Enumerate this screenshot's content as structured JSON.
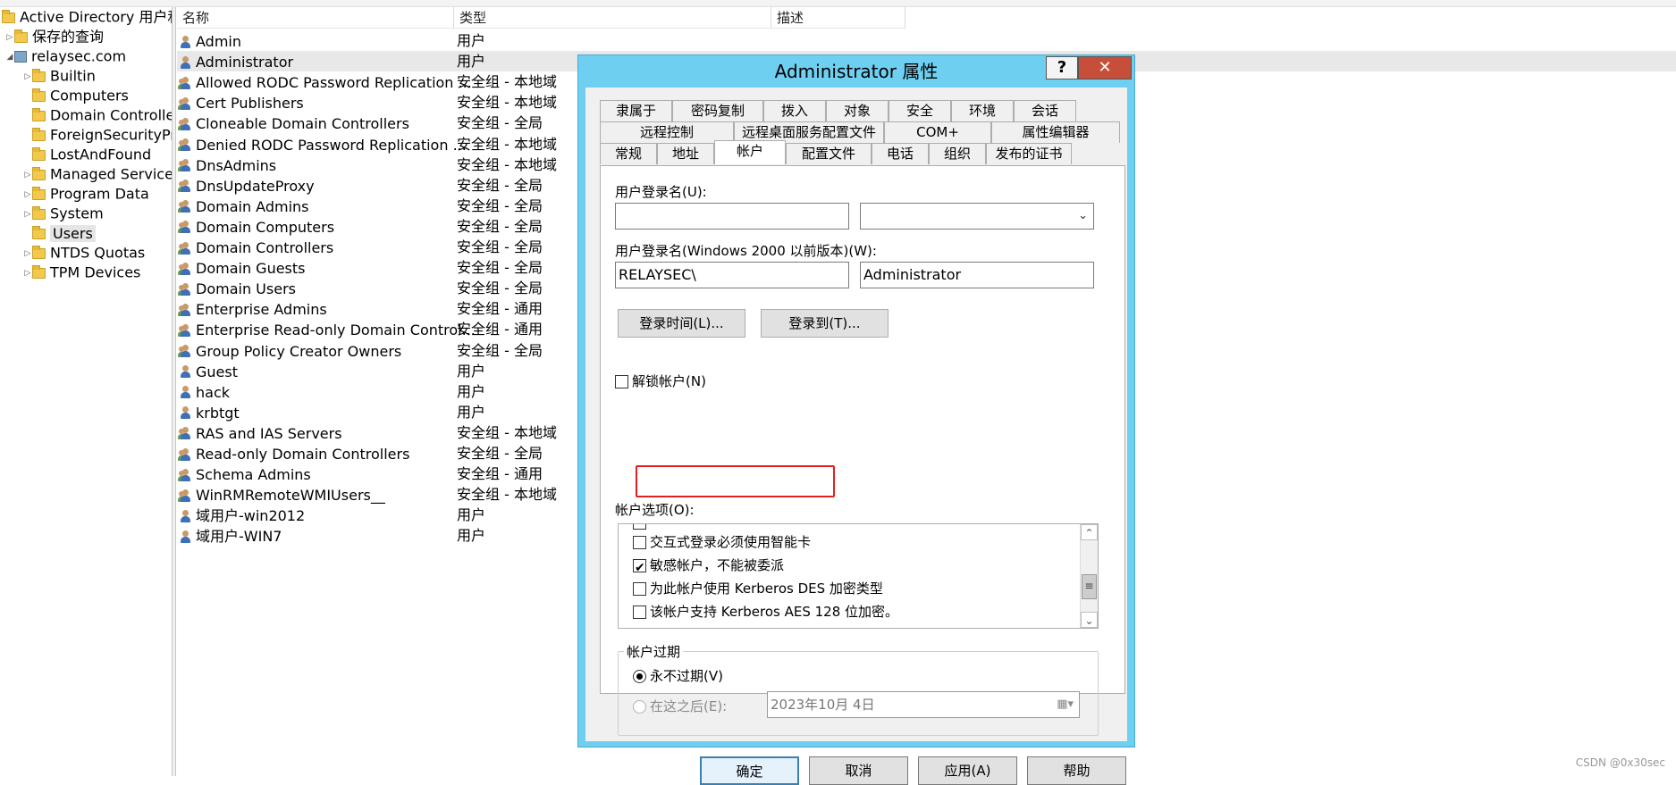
{
  "tree": {
    "items": [
      {
        "label": "Active Directory 用户和",
        "icon": "ad-root-icon",
        "expander": ""
      },
      {
        "label": "保存的查询",
        "icon": "folder-icon",
        "expander": "▷"
      },
      {
        "label": "relaysec.com",
        "icon": "domain-icon",
        "expander": "◢"
      },
      {
        "label": "Builtin",
        "icon": "folder-icon",
        "expander": "▷"
      },
      {
        "label": "Computers",
        "icon": "folder-icon",
        "expander": ""
      },
      {
        "label": "Domain Controlle",
        "icon": "folder-icon",
        "expander": ""
      },
      {
        "label": "ForeignSecurityPr",
        "icon": "folder-icon",
        "expander": ""
      },
      {
        "label": "LostAndFound",
        "icon": "folder-icon",
        "expander": ""
      },
      {
        "label": "Managed Service",
        "icon": "folder-icon",
        "expander": "▷"
      },
      {
        "label": "Program Data",
        "icon": "folder-icon",
        "expander": "▷"
      },
      {
        "label": "System",
        "icon": "folder-icon",
        "expander": "▷"
      },
      {
        "label": "Users",
        "icon": "folder-icon",
        "expander": ""
      },
      {
        "label": "NTDS Quotas",
        "icon": "folder-icon",
        "expander": "▷"
      },
      {
        "label": "TPM Devices",
        "icon": "folder-icon",
        "expander": "▷"
      }
    ]
  },
  "list": {
    "columns": [
      "名称",
      "类型",
      "描述"
    ],
    "rows": [
      {
        "name": "Admin",
        "type": "用户",
        "kind": "user"
      },
      {
        "name": "Administrator",
        "type": "用户",
        "kind": "user"
      },
      {
        "name": "Allowed RODC Password Replication ...",
        "type": "安全组 - 本地域",
        "kind": "group"
      },
      {
        "name": "Cert Publishers",
        "type": "安全组 - 本地域",
        "kind": "group"
      },
      {
        "name": "Cloneable Domain Controllers",
        "type": "安全组 - 全局",
        "kind": "group"
      },
      {
        "name": "Denied RODC Password Replication ...",
        "type": "安全组 - 本地域",
        "kind": "group"
      },
      {
        "name": "DnsAdmins",
        "type": "安全组 - 本地域",
        "kind": "group"
      },
      {
        "name": "DnsUpdateProxy",
        "type": "安全组 - 全局",
        "kind": "group"
      },
      {
        "name": "Domain Admins",
        "type": "安全组 - 全局",
        "kind": "group"
      },
      {
        "name": "Domain Computers",
        "type": "安全组 - 全局",
        "kind": "group"
      },
      {
        "name": "Domain Controllers",
        "type": "安全组 - 全局",
        "kind": "group"
      },
      {
        "name": "Domain Guests",
        "type": "安全组 - 全局",
        "kind": "group"
      },
      {
        "name": "Domain Users",
        "type": "安全组 - 全局",
        "kind": "group"
      },
      {
        "name": "Enterprise Admins",
        "type": "安全组 - 通用",
        "kind": "group"
      },
      {
        "name": "Enterprise Read-only Domain Control...",
        "type": "安全组 - 通用",
        "kind": "group"
      },
      {
        "name": "Group Policy Creator Owners",
        "type": "安全组 - 全局",
        "kind": "group"
      },
      {
        "name": "Guest",
        "type": "用户",
        "kind": "user"
      },
      {
        "name": "hack",
        "type": "用户",
        "kind": "user"
      },
      {
        "name": "krbtgt",
        "type": "用户",
        "kind": "user"
      },
      {
        "name": "RAS and IAS Servers",
        "type": "安全组 - 本地域",
        "kind": "group"
      },
      {
        "name": "Read-only Domain Controllers",
        "type": "安全组 - 全局",
        "kind": "group"
      },
      {
        "name": "Schema Admins",
        "type": "安全组 - 通用",
        "kind": "group"
      },
      {
        "name": "WinRMRemoteWMIUsers__",
        "type": "安全组 - 本地域",
        "kind": "group"
      },
      {
        "name": "域用户-win2012",
        "type": "用户",
        "kind": "user"
      },
      {
        "name": "域用户-WIN7",
        "type": "用户",
        "kind": "user"
      }
    ]
  },
  "dialog": {
    "title": "Administrator 属性",
    "help_label": "?",
    "close_label": "✕",
    "tabs_row1": [
      "隶属于",
      "密码复制",
      "拨入",
      "对象",
      "安全",
      "环境",
      "会话"
    ],
    "tabs_row2": [
      "远程控制",
      "远程桌面服务配置文件",
      "COM+",
      "属性编辑器"
    ],
    "tabs_row3": [
      "常规",
      "地址",
      "帐户",
      "配置文件",
      "电话",
      "组织",
      "发布的证书"
    ],
    "active_tab": "帐户",
    "upn_label": "用户登录名(U):",
    "upn_value": "",
    "upn_suffix": "",
    "sam_label": "用户登录名(Windows 2000 以前版本)(W):",
    "sam_domain": "RELAYSEC\\",
    "sam_name": "Administrator",
    "logon_hours_button": "登录时间(L)...",
    "logon_to_button": "登录到(T)...",
    "unlock_label": "解锁帐户(N)",
    "account_options_label": "帐户选项(O):",
    "options": [
      {
        "label": "交互式登录必须使用智能卡",
        "checked": false
      },
      {
        "label": "敏感帐户，不能被委派",
        "checked": true
      },
      {
        "label": "为此帐户使用 Kerberos DES 加密类型",
        "checked": false
      },
      {
        "label": "该帐户支持 Kerberos AES 128 位加密。",
        "checked": false
      }
    ],
    "expiry_group_label": "帐户过期",
    "never_expires_label": "永不过期(V)",
    "end_of_label": "在这之后(E):",
    "date_value": "2023年10月  4日",
    "ok_button": "确定",
    "cancel_button": "取消",
    "apply_button": "应用(A)",
    "help_button": "帮助"
  },
  "watermark": "CSDN @0x30sec",
  "colors": {
    "title_bar": "#6ecff0",
    "close_button": "#c74f3a",
    "highlight_box": "#e02020"
  }
}
